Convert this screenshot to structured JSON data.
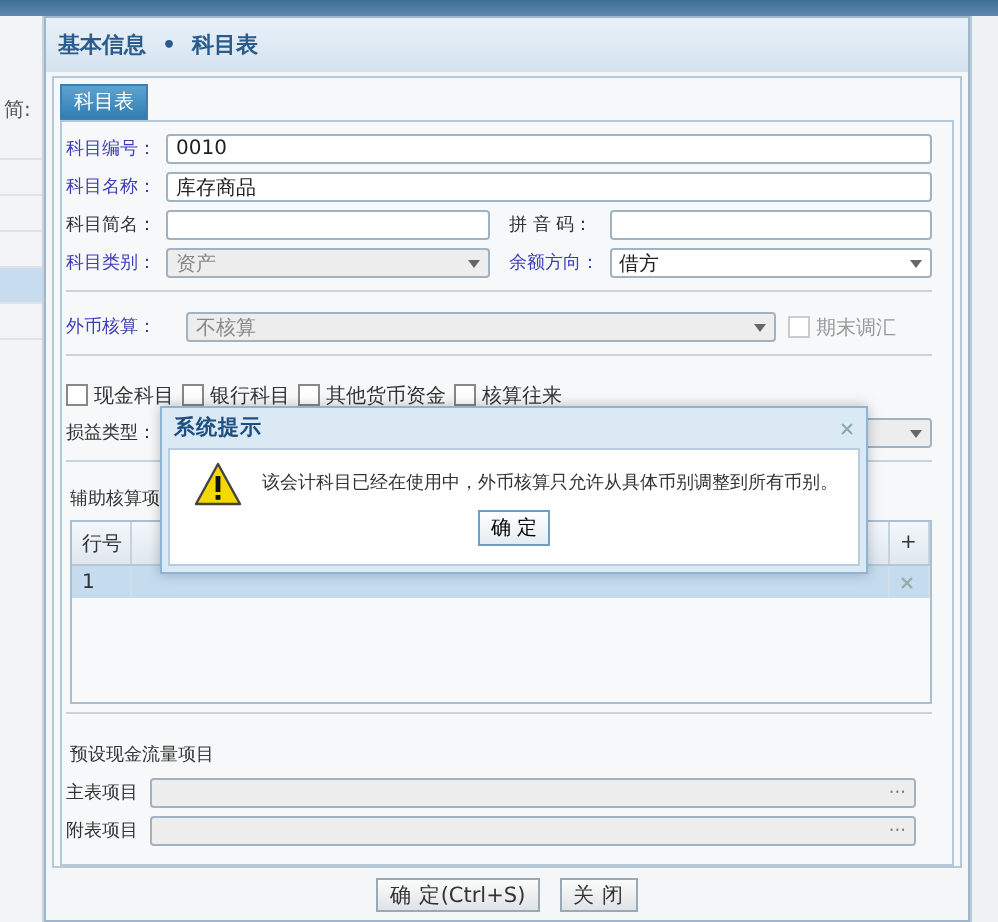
{
  "background_app": {
    "label_fragment": "简:"
  },
  "window": {
    "breadcrumb": [
      "基本信息",
      "科目表"
    ],
    "separator": "•"
  },
  "tabs": [
    {
      "label": "科目表",
      "selected": true
    }
  ],
  "rows": [
    [
      {
        "label": "科目编号：",
        "required": true,
        "kind": "text",
        "value": "0010",
        "disabled": false
      }
    ],
    [
      {
        "label": "科目名称：",
        "required": true,
        "kind": "text",
        "value": "库存商品",
        "disabled": false
      }
    ],
    [
      {
        "label": "科目简名：",
        "required": false,
        "kind": "text",
        "disabled": false
      },
      {
        "label": "拼 音 码：",
        "required": false,
        "kind": "text",
        "disabled": false
      }
    ],
    [
      {
        "label": "科目类别：",
        "required": true,
        "kind": "select",
        "value": "资产",
        "disabled": true
      },
      {
        "label": "余额方向：",
        "required": true,
        "kind": "select",
        "value": "借方",
        "disabled": false
      }
    ]
  ],
  "currency": {
    "label": "外币核算：",
    "value": "不核算",
    "disabled": true
  },
  "period_end": {
    "label": "期末调汇",
    "checked": false,
    "disabled": true
  },
  "checkboxes": [
    {
      "label": "现金科目",
      "checked": false
    },
    {
      "label": "银行科目",
      "checked": false
    },
    {
      "label": "其他货币资金",
      "checked": false
    },
    {
      "label": "核算往来",
      "checked": false
    }
  ],
  "profit_type": {
    "label": "损益类型："
  },
  "aux": {
    "title": "辅助核算项",
    "columns": [
      "行号"
    ],
    "add": "+",
    "rows": [
      {
        "number": "1",
        "selected": true
      }
    ]
  },
  "cashflow": {
    "title": "预设现金流量项目",
    "fields": [
      {
        "label": "主表项目",
        "button": "···"
      },
      {
        "label": "附表项目",
        "button": "···"
      }
    ]
  },
  "buttons": [
    "确 定(Ctrl+S)",
    "关 闭"
  ],
  "dialog": {
    "title": "系统提示",
    "message": "该会计科目已经在使用中，外币核算只允许从具体币别调整到所有币别。",
    "ok": "确 定"
  }
}
